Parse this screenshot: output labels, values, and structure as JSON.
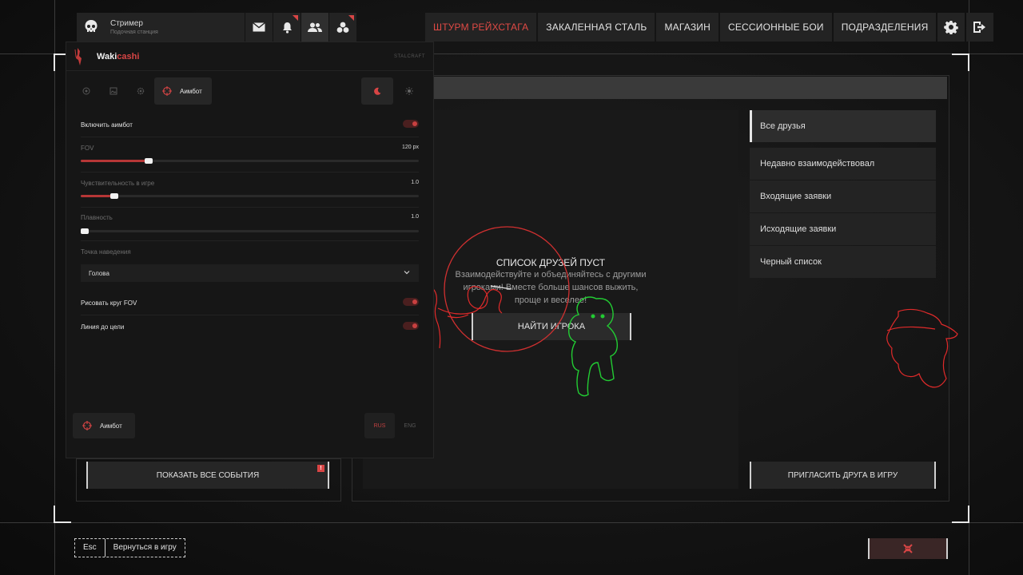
{
  "profile": {
    "name": "Стример",
    "subtitle": "Подочная станция"
  },
  "nav": {
    "tabs": [
      {
        "label": "ШТУРМ РЕЙХСТАГА"
      },
      {
        "label": "ЗАКАЛЕННАЯ СТАЛЬ"
      },
      {
        "label": "МАГАЗИН"
      },
      {
        "label": "СЕССИОННЫЕ БОИ"
      },
      {
        "label": "ПОДРАЗДЕЛЕНИЯ"
      }
    ]
  },
  "friends": {
    "empty_title": "СПИСОК ДРУЗЕЙ ПУСТ",
    "empty_desc": "Взаимодействуйте и объединяйтесь с другими игроками! Вместе больше шансов выжить, проще и веселее!",
    "find_button": "НАЙТИ ИГРОКА",
    "filters": [
      {
        "label": "Все друзья"
      },
      {
        "label": "Недавно взаимодействовал"
      },
      {
        "label": "Входящие заявки"
      },
      {
        "label": "Исходящие заявки"
      },
      {
        "label": "Черный список"
      }
    ],
    "invite_button": "ПРИГЛАСИТЬ ДРУГА В ИГРУ"
  },
  "events_button": "ПОКАЗАТЬ ВСЕ СОБЫТИЯ",
  "bottom": {
    "esc_key": "Esc",
    "return_label": "Вернуться в игру"
  },
  "overlay": {
    "brand_a": "Waki",
    "brand_b": "cashi",
    "brand_right": "STALCRAFT",
    "active_tab": "Аимбот",
    "options": {
      "enable_aimbot": "Включить аимбот",
      "fov_label": "FOV",
      "fov_value": "120 px",
      "fov_level": 0.2,
      "sens_label": "Чувствительность в игре",
      "sens_value": "1.0",
      "sens_level": 0.1,
      "smooth_label": "Плавность",
      "smooth_value": "1.0",
      "smooth_level": 0.01,
      "aim_point_label": "Точка наведения",
      "aim_point_value": "Голова",
      "draw_fov": "Рисовать круг FOV",
      "line_to_target": "Линия до цели"
    },
    "footer_button": "Аимбот",
    "lang_rus": "RUS",
    "lang_eng": "ENG"
  },
  "colors": {
    "accent": "#d84545",
    "panel": "#232323",
    "background": "#141414",
    "esp_enemy": "#e02a2a",
    "esp_friend": "#22cc33"
  }
}
